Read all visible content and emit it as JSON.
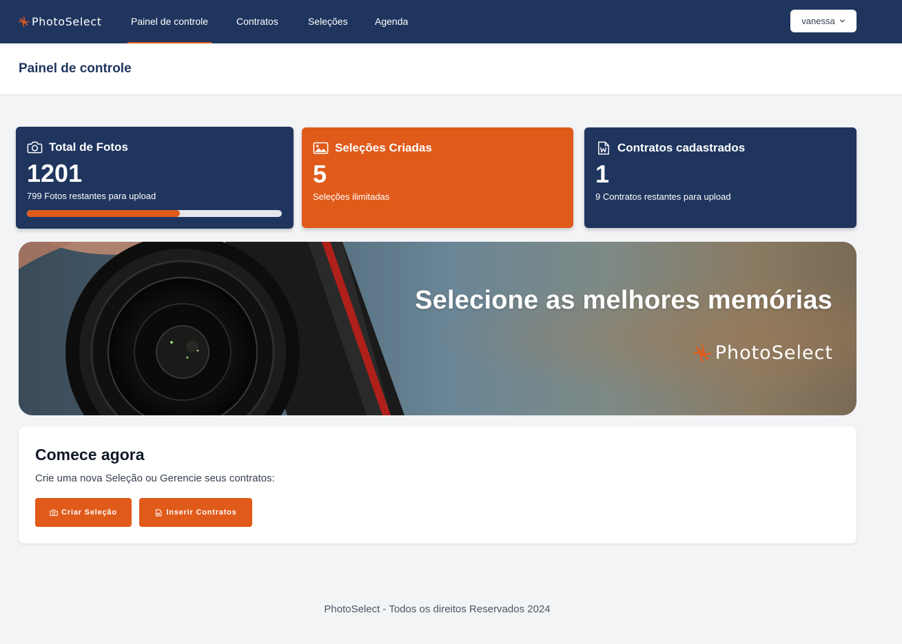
{
  "brand": {
    "name": "PhotoSelect",
    "accent": "#e05a1a",
    "primary": "#1f355e"
  },
  "nav": {
    "items": [
      {
        "label": "Painel de controle",
        "active": true
      },
      {
        "label": "Contratos",
        "active": false
      },
      {
        "label": "Seleções",
        "active": false
      },
      {
        "label": "Agenda",
        "active": false
      }
    ],
    "user": {
      "name": "vanessa",
      "icon": "chevron-down-icon"
    }
  },
  "page": {
    "title": "Painel de controle"
  },
  "stats": [
    {
      "icon": "camera-icon",
      "label": "Total de Fotos",
      "value": "1201",
      "subtext": "799 Fotos restantes para upload",
      "progress_percent": 60
    },
    {
      "icon": "image-icon",
      "label": "Seleções Criadas",
      "value": "5",
      "subtext": "Seleções ilimitadas"
    },
    {
      "icon": "document-word-icon",
      "label": "Contratos cadastrados",
      "value": "1",
      "subtext": "9 Contratos restantes para upload"
    }
  ],
  "banner": {
    "title": "Selecione as melhores memórias",
    "logo_text": "PhotoSelect"
  },
  "start": {
    "title": "Comece agora",
    "text": "Crie uma nova Seleção ou Gerencie seus contratos:",
    "buttons": [
      {
        "label": "Criar Seleção",
        "icon": "camera-icon"
      },
      {
        "label": "Inserir Contratos",
        "icon": "document-word-icon"
      }
    ]
  },
  "footer": {
    "text": "PhotoSelect - Todos os direitos Reservados 2024"
  }
}
